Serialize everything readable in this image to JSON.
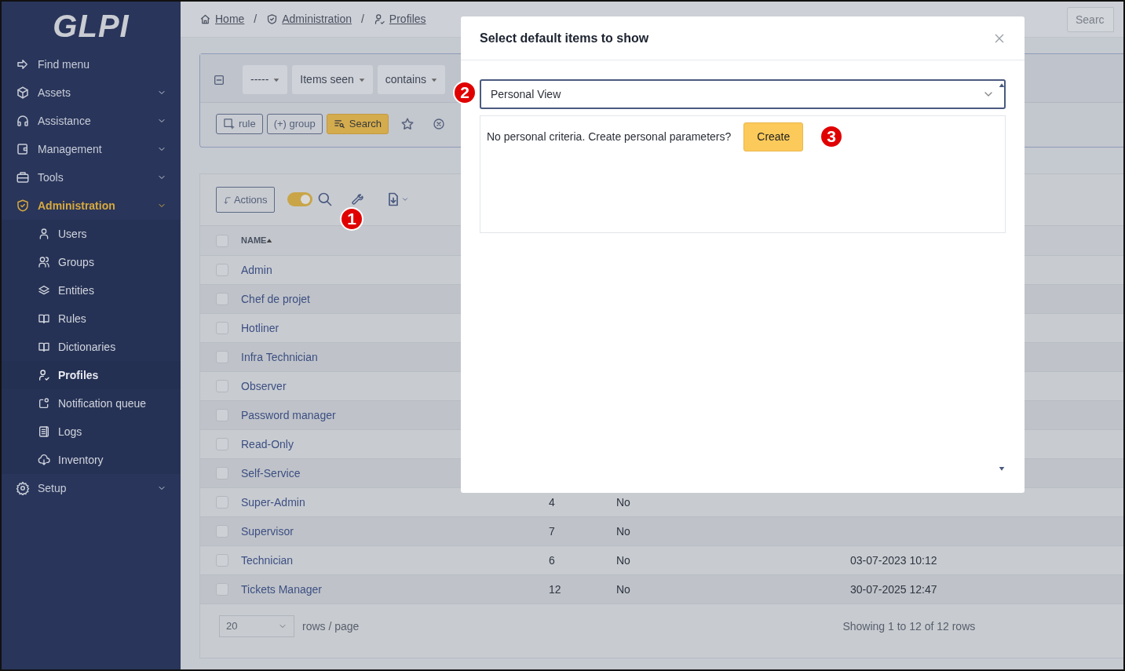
{
  "logo": {
    "text": "GLPI"
  },
  "breadcrumb": [
    {
      "label": "Home"
    },
    {
      "separator": "/",
      "label": "Administration"
    },
    {
      "separator": "/",
      "label": "Profiles"
    }
  ],
  "global_search": {
    "placeholder": "Searc"
  },
  "sidebar": {
    "items": [
      {
        "label": "Find menu",
        "selected": false,
        "has_children": false
      },
      {
        "label": "Assets",
        "selected": false,
        "has_children": true
      },
      {
        "label": "Assistance",
        "selected": false,
        "has_children": true
      },
      {
        "label": "Management",
        "selected": false,
        "has_children": true
      },
      {
        "label": "Tools",
        "selected": false,
        "has_children": true
      },
      {
        "label": "Administration",
        "selected": true,
        "has_children": true,
        "children": [
          {
            "label": "Users",
            "selected": false
          },
          {
            "label": "Groups",
            "selected": false
          },
          {
            "label": "Entities",
            "selected": false
          },
          {
            "label": "Rules",
            "selected": false
          },
          {
            "label": "Dictionaries",
            "selected": false
          },
          {
            "label": "Profiles",
            "selected": true
          },
          {
            "label": "Notification queue",
            "selected": false
          },
          {
            "label": "Logs",
            "selected": false
          },
          {
            "label": "Inventory",
            "selected": false
          }
        ]
      },
      {
        "label": "Setup",
        "selected": false,
        "has_children": true
      }
    ]
  },
  "search_panel": {
    "criteria": [
      "-----",
      "Items seen",
      "contains"
    ],
    "buttons": [
      {
        "label": "rule",
        "kind": "outline"
      },
      {
        "label": "(+) group",
        "kind": "outline"
      },
      {
        "label": "Search",
        "kind": "warning"
      }
    ]
  },
  "toolbar": {
    "actions_label": "Actions",
    "switch_on": true
  },
  "table": {
    "columns": [
      "NAME"
    ],
    "all_checked": false,
    "rows": [
      {
        "checked": false,
        "name": "Admin"
      },
      {
        "checked": false,
        "name": "Chef de projet"
      },
      {
        "checked": false,
        "name": "Hotliner"
      },
      {
        "checked": false,
        "name": "Infra Technician"
      },
      {
        "checked": false,
        "name": "Observer"
      },
      {
        "checked": false,
        "name": "Password manager"
      },
      {
        "checked": false,
        "name": "Read-Only"
      },
      {
        "checked": false,
        "name": "Self-Service"
      },
      {
        "checked": false,
        "name": "Super-Admin",
        "column_2": "4",
        "column_3": "No"
      },
      {
        "checked": false,
        "name": "Supervisor",
        "column_2": "7",
        "column_3": "No"
      },
      {
        "checked": false,
        "name": "Technician",
        "column_2": "6",
        "column_3": "No",
        "column_4": "03-07-2023 10:12"
      },
      {
        "checked": false,
        "name": "Tickets Manager",
        "column_2": "12",
        "column_3": "No",
        "column_4": "30-07-2025 12:47"
      }
    ]
  },
  "pagination": {
    "page_size": "20",
    "page_size_label": "rows / page",
    "summary": "Showing 1 to 12 of 12 rows"
  },
  "modal": {
    "title": "Select default items to show",
    "view_select": "Personal View",
    "message": "No personal criteria. Create personal parameters?",
    "create_button": "Create"
  },
  "annotations": [
    {
      "text": "1"
    },
    {
      "text": "2"
    },
    {
      "text": "3"
    }
  ]
}
